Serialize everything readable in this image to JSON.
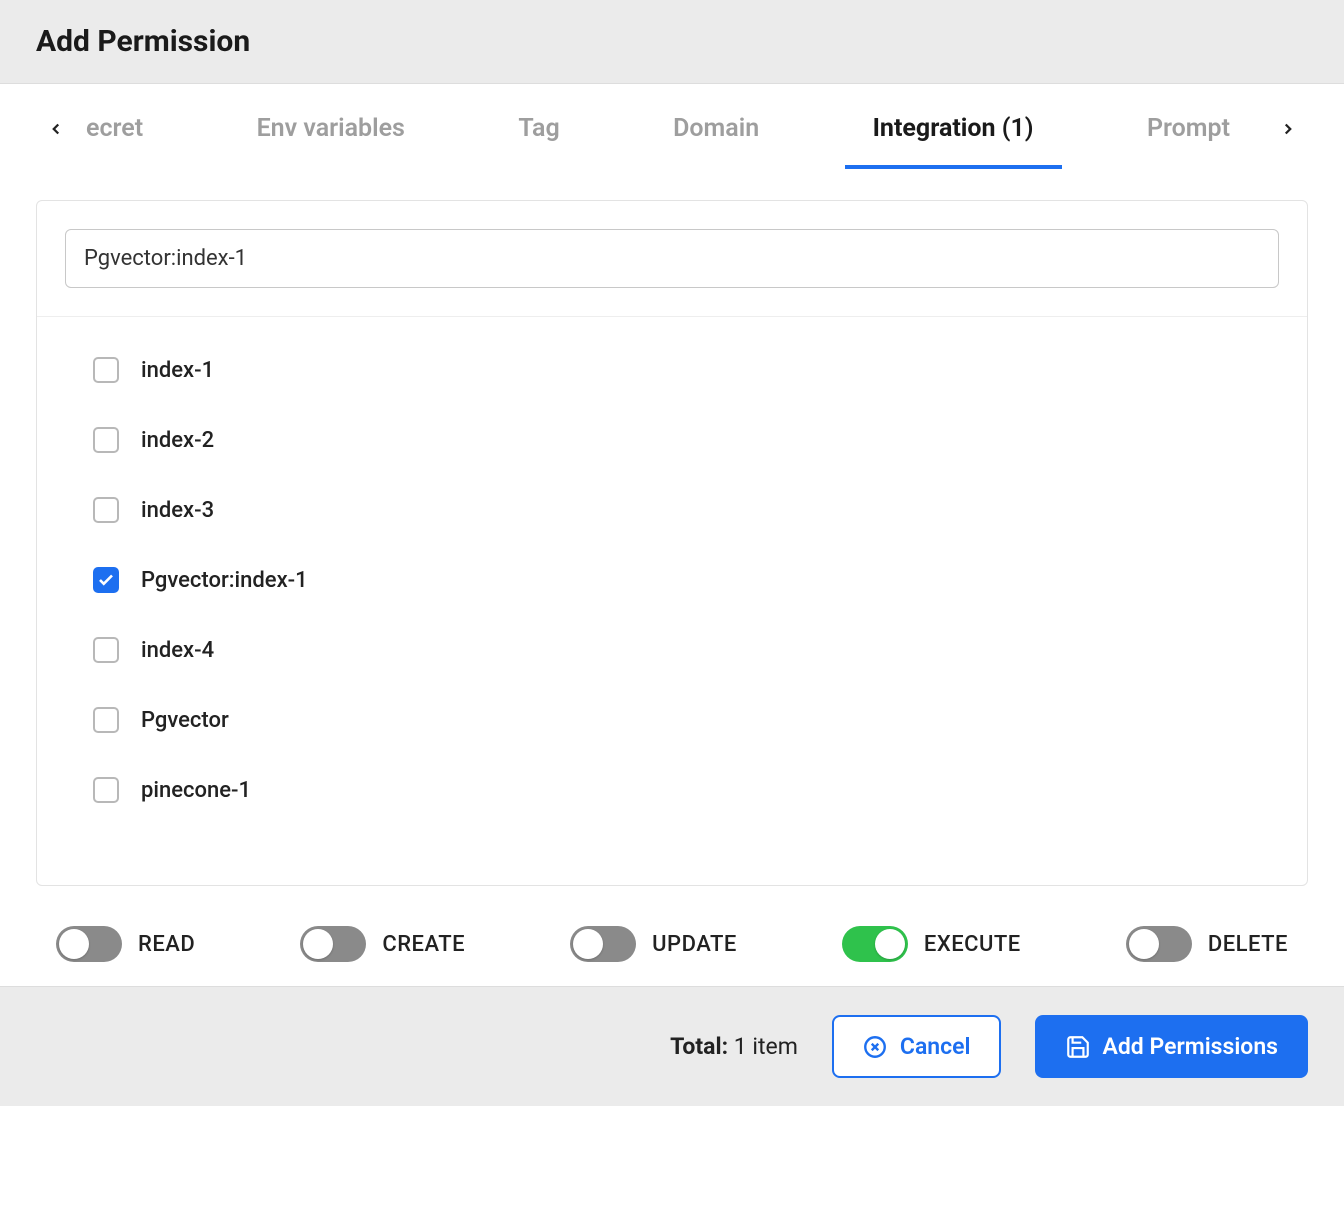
{
  "header": {
    "title": "Add Permission"
  },
  "tabs": {
    "items": [
      {
        "label": "ecret",
        "partial": true
      },
      {
        "label": "Env variables"
      },
      {
        "label": "Tag"
      },
      {
        "label": "Domain"
      },
      {
        "label": "Integration",
        "count": "(1)",
        "active": true
      },
      {
        "label": "Prompt"
      }
    ]
  },
  "search": {
    "value": "Pgvector:index-1"
  },
  "items": [
    {
      "label": "index-1",
      "checked": false
    },
    {
      "label": "index-2",
      "checked": false
    },
    {
      "label": "index-3",
      "checked": false
    },
    {
      "label": "Pgvector:index-1",
      "checked": true
    },
    {
      "label": "index-4",
      "checked": false
    },
    {
      "label": "Pgvector",
      "checked": false
    },
    {
      "label": "pinecone-1",
      "checked": false
    }
  ],
  "toggles": [
    {
      "label": "READ",
      "on": false
    },
    {
      "label": "CREATE",
      "on": false
    },
    {
      "label": "UPDATE",
      "on": false
    },
    {
      "label": "EXECUTE",
      "on": true
    },
    {
      "label": "DELETE",
      "on": false
    }
  ],
  "footer": {
    "total_label": "Total:",
    "total_value": "1 item",
    "cancel": "Cancel",
    "submit": "Add Permissions"
  }
}
